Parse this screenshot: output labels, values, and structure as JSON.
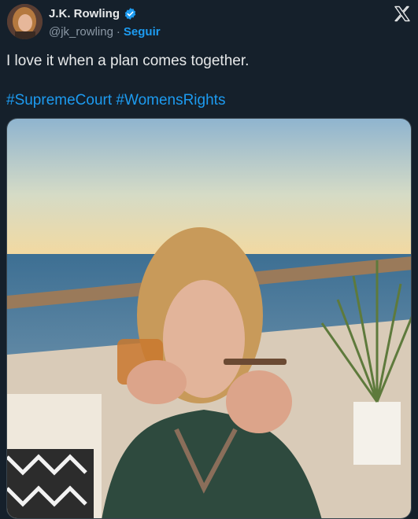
{
  "author": {
    "name": "J.K. Rowling",
    "handle": "@jk_rowling",
    "separator": "·",
    "follow_label": "Seguir"
  },
  "tweet": {
    "text": "I love it when a plan comes together.",
    "hashtags": [
      "#SupremeCourt",
      "#WomensRights"
    ]
  },
  "icons": {
    "verified": "verified-badge-icon",
    "close": "x-logo-icon"
  },
  "colors": {
    "background": "#15202b",
    "link": "#1d9bf0",
    "secondary_text": "#8b98a5"
  }
}
